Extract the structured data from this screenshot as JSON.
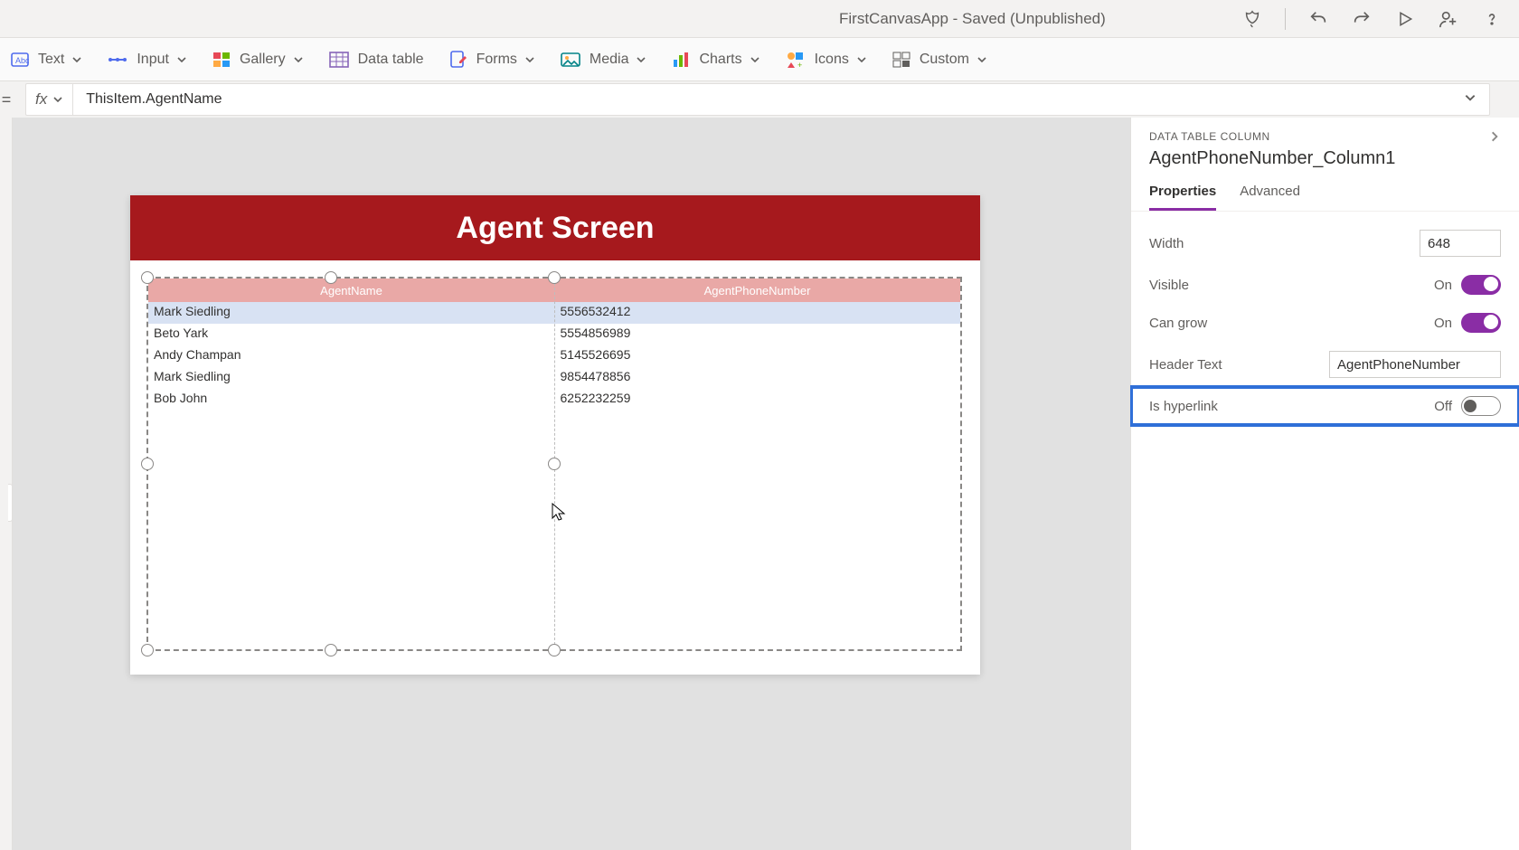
{
  "titlebar": {
    "app_title": "FirstCanvasApp - Saved (Unpublished)"
  },
  "ribbon": {
    "text_label": "Text",
    "input_label": "Input",
    "gallery_label": "Gallery",
    "datatable_label": "Data table",
    "forms_label": "Forms",
    "media_label": "Media",
    "charts_label": "Charts",
    "icons_label": "Icons",
    "custom_label": "Custom"
  },
  "formula": {
    "fx_label": "fx",
    "value": "ThisItem.AgentName"
  },
  "canvas": {
    "screen_title": "Agent Screen",
    "table": {
      "columns": [
        "AgentName",
        "AgentPhoneNumber"
      ],
      "rows": [
        {
          "name": "Mark Siedling",
          "phone": "5556532412"
        },
        {
          "name": "Beto Yark",
          "phone": "5554856989"
        },
        {
          "name": "Andy Champan",
          "phone": "5145526695"
        },
        {
          "name": "Mark Siedling",
          "phone": "9854478856"
        },
        {
          "name": "Bob John",
          "phone": "6252232259"
        }
      ]
    }
  },
  "props": {
    "category": "DATA TABLE COLUMN",
    "title": "AgentPhoneNumber_Column1",
    "tabs": {
      "properties": "Properties",
      "advanced": "Advanced"
    },
    "width": {
      "label": "Width",
      "value": "648"
    },
    "visible": {
      "label": "Visible",
      "value": "On"
    },
    "cangrow": {
      "label": "Can grow",
      "value": "On"
    },
    "headertext": {
      "label": "Header Text",
      "value": "AgentPhoneNumber"
    },
    "hyperlink": {
      "label": "Is hyperlink",
      "value": "Off"
    }
  }
}
